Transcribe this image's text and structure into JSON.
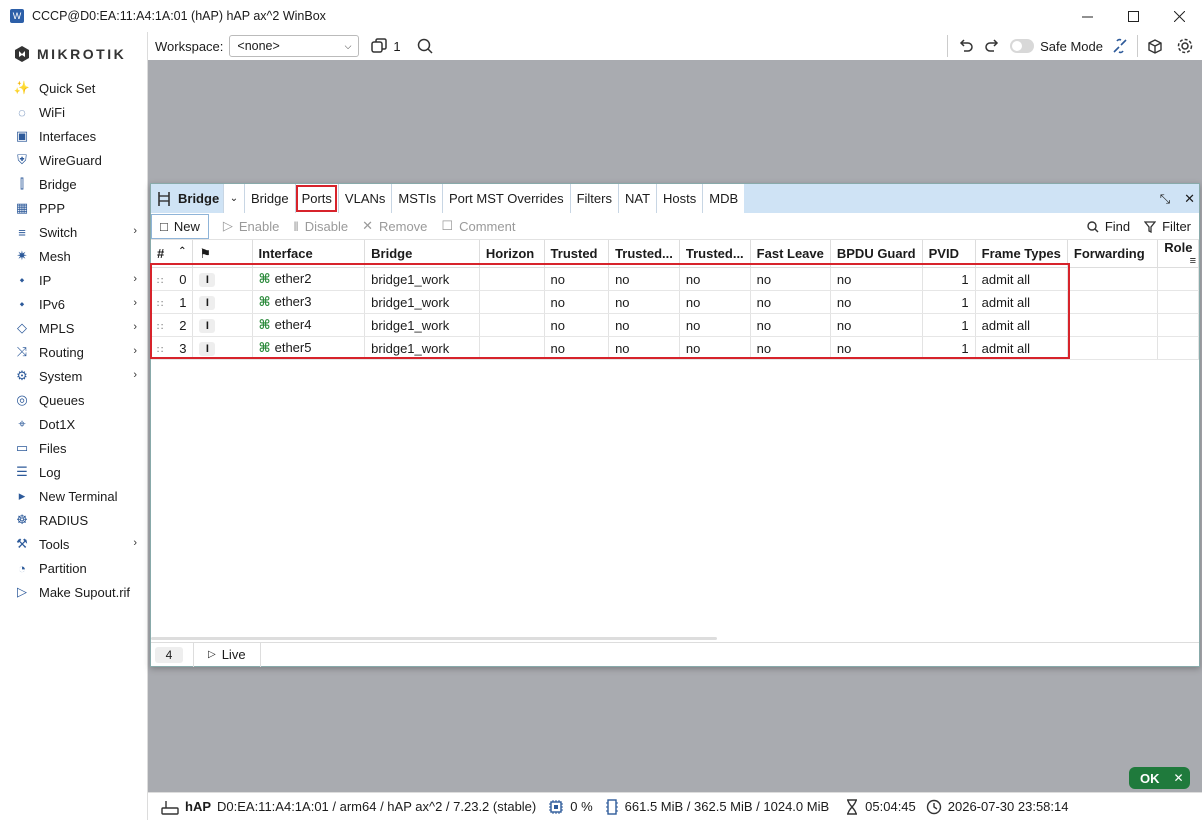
{
  "window": {
    "title": "CCCP@D0:EA:11:A4:1A:01 (hAP) hAP ax^2 WinBox",
    "controls": [
      "minimize-icon",
      "maximize-icon",
      "close-icon"
    ]
  },
  "brand": {
    "logo_text": "MIKROTIK"
  },
  "sidebar": {
    "items": [
      {
        "label": "Quick Set",
        "icon": "wand-icon",
        "submenu": false
      },
      {
        "label": "WiFi",
        "icon": "wifi-icon",
        "submenu": false
      },
      {
        "label": "Interfaces",
        "icon": "interfaces-icon",
        "submenu": false
      },
      {
        "label": "WireGuard",
        "icon": "wireguard-icon",
        "submenu": false
      },
      {
        "label": "Bridge",
        "icon": "bridge-icon",
        "submenu": false
      },
      {
        "label": "PPP",
        "icon": "ppp-icon",
        "submenu": false
      },
      {
        "label": "Switch",
        "icon": "switch-icon",
        "submenu": true
      },
      {
        "label": "Mesh",
        "icon": "mesh-icon",
        "submenu": false
      },
      {
        "label": "IP",
        "icon": "ip-icon",
        "submenu": true
      },
      {
        "label": "IPv6",
        "icon": "ipv6-icon",
        "submenu": true
      },
      {
        "label": "MPLS",
        "icon": "mpls-icon",
        "submenu": true
      },
      {
        "label": "Routing",
        "icon": "routing-icon",
        "submenu": true
      },
      {
        "label": "System",
        "icon": "gear-icon",
        "submenu": true
      },
      {
        "label": "Queues",
        "icon": "queues-icon",
        "submenu": false
      },
      {
        "label": "Dot1X",
        "icon": "dot1x-icon",
        "submenu": false
      },
      {
        "label": "Files",
        "icon": "folder-icon",
        "submenu": false
      },
      {
        "label": "Log",
        "icon": "log-icon",
        "submenu": false
      },
      {
        "label": "New Terminal",
        "icon": "terminal-icon",
        "submenu": false
      },
      {
        "label": "RADIUS",
        "icon": "radius-icon",
        "submenu": false
      },
      {
        "label": "Tools",
        "icon": "tools-icon",
        "submenu": true
      },
      {
        "label": "Partition",
        "icon": "partition-icon",
        "submenu": false
      },
      {
        "label": "Make Supout.rif",
        "icon": "supout-icon",
        "submenu": false
      }
    ]
  },
  "topbar": {
    "workspace_label": "Workspace:",
    "workspace_value": "<none>",
    "windows_count": "1",
    "safe_mode_label": "Safe Mode"
  },
  "bridge_window": {
    "title": "Bridge",
    "tabs": [
      {
        "label": "Bridge",
        "active": false
      },
      {
        "label": "Ports",
        "active": true
      },
      {
        "label": "VLANs",
        "active": false
      },
      {
        "label": "MSTIs",
        "active": false
      },
      {
        "label": "Port MST Overrides",
        "active": false
      },
      {
        "label": "Filters",
        "active": false
      },
      {
        "label": "NAT",
        "active": false
      },
      {
        "label": "Hosts",
        "active": false
      },
      {
        "label": "MDB",
        "active": false
      }
    ],
    "actions": {
      "new": "New",
      "enable": "Enable",
      "disable": "Disable",
      "remove": "Remove",
      "comment": "Comment",
      "find": "Find",
      "filter": "Filter"
    },
    "columns": [
      "#",
      "",
      "Interface",
      "Bridge",
      "Horizon",
      "Trusted",
      "Trusted...",
      "Trusted...",
      "Fast Leave",
      "BPDU Guard",
      "PVID",
      "Frame Types",
      "Forwarding",
      "Role"
    ],
    "rows": [
      {
        "num": "0",
        "flag": "I",
        "interface": "ether2",
        "bridge": "bridge1_work",
        "horizon": "",
        "trusted": "no",
        "trusted2": "no",
        "trusted3": "no",
        "fast_leave": "no",
        "bpdu_guard": "no",
        "pvid": "1",
        "frame_types": "admit all",
        "forwarding": "",
        "role": ""
      },
      {
        "num": "1",
        "flag": "I",
        "interface": "ether3",
        "bridge": "bridge1_work",
        "horizon": "",
        "trusted": "no",
        "trusted2": "no",
        "trusted3": "no",
        "fast_leave": "no",
        "bpdu_guard": "no",
        "pvid": "1",
        "frame_types": "admit all",
        "forwarding": "",
        "role": ""
      },
      {
        "num": "2",
        "flag": "I",
        "interface": "ether4",
        "bridge": "bridge1_work",
        "horizon": "",
        "trusted": "no",
        "trusted2": "no",
        "trusted3": "no",
        "fast_leave": "no",
        "bpdu_guard": "no",
        "pvid": "1",
        "frame_types": "admit all",
        "forwarding": "",
        "role": ""
      },
      {
        "num": "3",
        "flag": "I",
        "interface": "ether5",
        "bridge": "bridge1_work",
        "horizon": "",
        "trusted": "no",
        "trusted2": "no",
        "trusted3": "no",
        "fast_leave": "no",
        "bpdu_guard": "no",
        "pvid": "1",
        "frame_types": "admit all",
        "forwarding": "",
        "role": ""
      }
    ],
    "footer": {
      "count": "4",
      "live_label": "Live"
    }
  },
  "ok_badge": "OK",
  "statusbar": {
    "device": "hAP",
    "device_info": "D0:EA:11:A4:1A:01 / arm64 / hAP ax^2 / 7.23.2 (stable)",
    "cpu": "0 %",
    "memory": "661.5 MiB / 362.5 MiB / 1024.0 MiB",
    "uptime": "05:04:45",
    "datetime": "2026-07-30 23:58:14"
  },
  "colors": {
    "accent": "#2d5a9a",
    "tab_header": "#cfe3f5",
    "highlight": "#d7232b",
    "ok_green": "#1f7a3c",
    "workspace_bg": "#a9abb0"
  }
}
